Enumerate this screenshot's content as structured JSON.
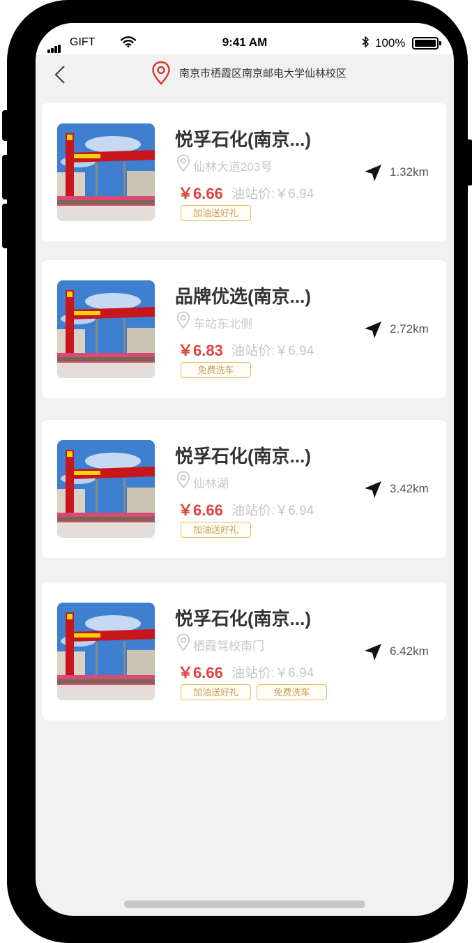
{
  "status_bar": {
    "carrier": "GIFT",
    "time": "9:41 AM",
    "battery": "100%"
  },
  "nav": {
    "location": "南京市栖霞区南京邮电大学仙林校区"
  },
  "stations": [
    {
      "name": "悦孚石化(南京...)",
      "address": "仙林大道203号",
      "price": "￥6.66",
      "station_price": "油站价:￥6.94",
      "tags": [
        "加油送好礼"
      ],
      "distance": "1.32km"
    },
    {
      "name": "品牌优选(南京...)",
      "address": "车站东北侧",
      "price": "￥6.83",
      "station_price": "油站价:￥6.94",
      "tags": [
        "免费洗车"
      ],
      "distance": "2.72km"
    },
    {
      "name": "悦孚石化(南京...)",
      "address": "仙林湖",
      "price": "￥6.66",
      "station_price": "油站价:￥6.94",
      "tags": [
        "加油送好礼"
      ],
      "distance": "3.42km"
    },
    {
      "name": "悦孚石化(南京...)",
      "address": "栖霞驾校南门",
      "price": "￥6.66",
      "station_price": "油站价:￥6.94",
      "tags": [
        "加油送好礼",
        "免费洗车"
      ],
      "distance": "6.42km"
    }
  ],
  "colors": {
    "price_red": "#e0413d",
    "tag_gold": "#e8b85a",
    "location_pin": "#d9362b",
    "background": "#f1f1f1"
  },
  "icons": {
    "back": "chevron-left-icon",
    "location": "location-pin-icon",
    "address": "map-pin-outline-icon",
    "navigate": "navigation-arrow-icon"
  }
}
